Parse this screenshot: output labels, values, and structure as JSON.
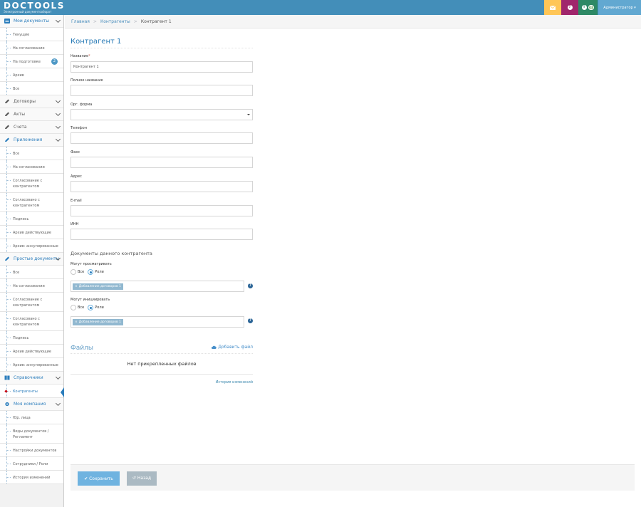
{
  "app": {
    "logo": "DOCTOOLS",
    "subtitle": "Электронный документооборот"
  },
  "topbar": {
    "mail_icon": "envelope-icon",
    "help_icon": "question-icon",
    "info_badge": "0",
    "user": "Администратор ▾"
  },
  "sidebar": {
    "my_docs": "Мои документы",
    "my_docs_items": [
      "Текущие",
      "На согласование",
      "На подготовке",
      "Архив",
      "Все"
    ],
    "preparing_count": "2",
    "contracts": "Договоры",
    "acts": "Акты",
    "invoices": "Счета",
    "attachments": "Приложения",
    "attachments_items": [
      "Все",
      "На согласовании",
      "Согласование с контрагентом",
      "Согласовано с контрагентом",
      "Подпись",
      "Архив действующие",
      "Архив: аннулированные"
    ],
    "simple_docs": "Простые документы",
    "simple_items": [
      "Все",
      "На согласовании",
      "Согласование с контрагентом",
      "Согласовано с контрагентом",
      "Подпись",
      "Архив действующие",
      "Архив: аннулированные"
    ],
    "references": "Справочники",
    "references_items": [
      "Контрагенты"
    ],
    "my_company": "Моя компания",
    "company_items": [
      "Юр. лица",
      "Виды документов / Регламент",
      "Настройки документов",
      "Сотрудники / Роли",
      "История изменений"
    ]
  },
  "breadcrumb": {
    "home": "Главная",
    "counterparties": "Контрагенты",
    "current": "Контрагент 1",
    "sep": ">"
  },
  "form": {
    "title": "Контрагент 1",
    "name_label": "Название",
    "required_mark": "*",
    "name_value": "Контрагент 1",
    "full_name_label": "Полное название",
    "org_form_label": "Орг. форма",
    "phone_label": "Телефон",
    "fax_label": "Факс",
    "address_label": "Адрес",
    "email_label": "E-mail",
    "inn_label": "ИНН",
    "docs_section": "Документы данного контрагента",
    "can_view_label": "Могут просматривать",
    "can_initiate_label": "Могут инициировать",
    "radio_all": "Все",
    "radio_roles": "Роли",
    "view_tag": "Добавление договоров 1",
    "initiate_tag": "Добавление договоров 1",
    "tag_remove": "×",
    "help_glyph": "?"
  },
  "files": {
    "title": "Файлы",
    "add": "Добавить файл",
    "empty": "Нет прикрепленных файлов",
    "history": "История изменений"
  },
  "actions": {
    "save": "✔ Сохранить",
    "back": "↺ Назад"
  },
  "colors": {
    "topbar": "#438eb9",
    "mail": "#ffc657",
    "help": "#a0266c",
    "info": "#2e8965",
    "user": "#62a8d1",
    "accent": "#2b7dbc"
  }
}
